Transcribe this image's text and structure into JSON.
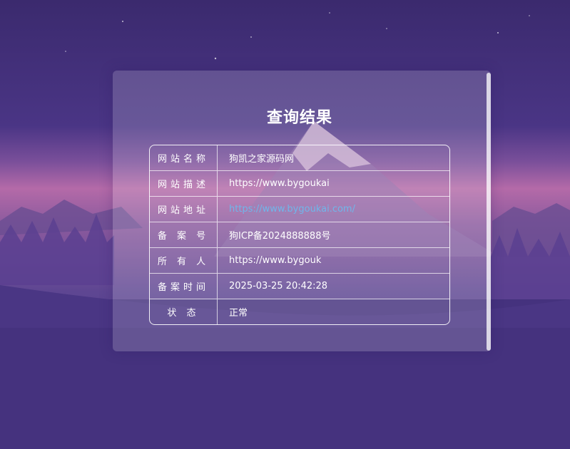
{
  "result": {
    "title": "查询结果",
    "rows": [
      {
        "label": "网站名称",
        "value": "狗凯之家源码网"
      },
      {
        "label": "网站描述",
        "value": "https://www.bygoukai"
      },
      {
        "label": "网站地址",
        "value": "https://www.bygoukai.com/"
      },
      {
        "label": "备 案 号",
        "value": "狗ICP备2024888888号"
      },
      {
        "label": "所 有 人",
        "value": "https://www.bygouk"
      },
      {
        "label": "备案时间",
        "value": "2025-03-25 20:42:28"
      },
      {
        "label": "状    态",
        "value": "正常"
      }
    ]
  },
  "colors": {
    "background": "#3f2f78",
    "link": "#6fb6ea",
    "text": "#ffffff"
  }
}
